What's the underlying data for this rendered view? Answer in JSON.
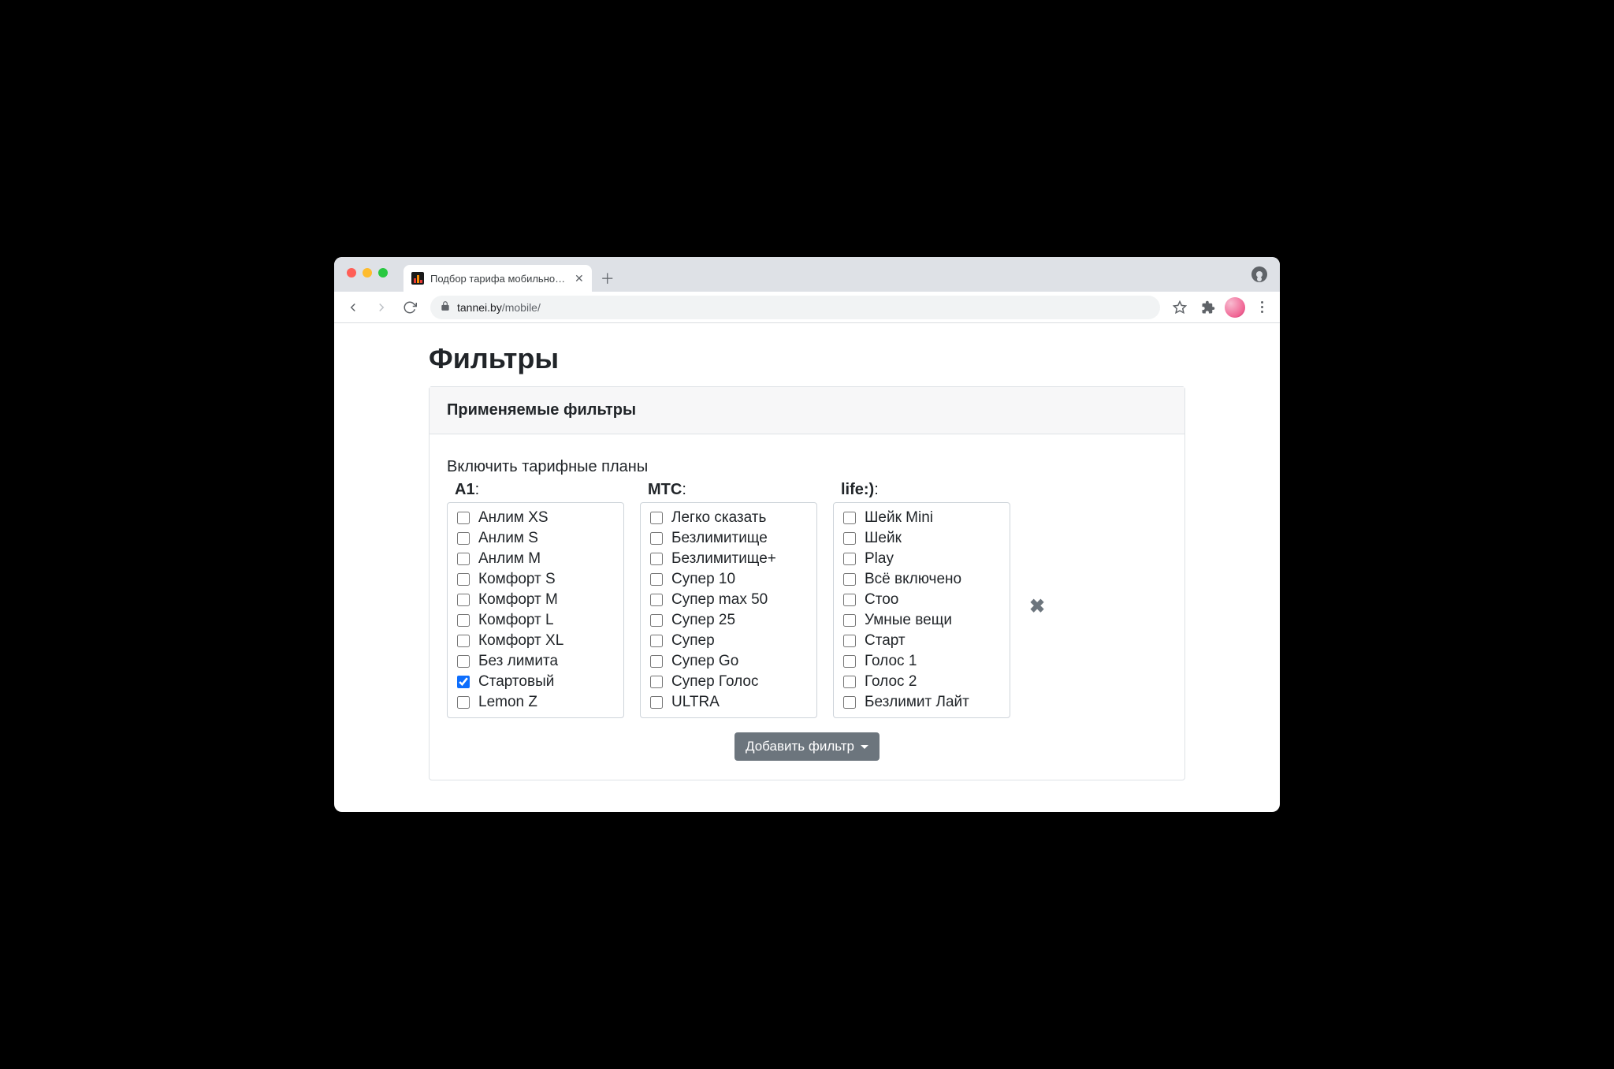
{
  "browser": {
    "tab_title": "Подбор тарифа мобильного о",
    "url_domain": "tannei.by",
    "url_path": "/mobile/"
  },
  "page": {
    "heading": "Фильтры",
    "card_header": "Применяемые фильтры",
    "section_label": "Включить тарифные планы",
    "add_filter_label": "Добавить фильтр",
    "operators": [
      {
        "name": "A1",
        "plans": [
          {
            "label": "Анлим XS",
            "checked": false
          },
          {
            "label": "Анлим S",
            "checked": false
          },
          {
            "label": "Анлим M",
            "checked": false
          },
          {
            "label": "Комфорт S",
            "checked": false
          },
          {
            "label": "Комфорт M",
            "checked": false
          },
          {
            "label": "Комфорт L",
            "checked": false
          },
          {
            "label": "Комфорт XL",
            "checked": false
          },
          {
            "label": "Без лимита",
            "checked": false
          },
          {
            "label": "Стартовый",
            "checked": true
          },
          {
            "label": "Lemon Z",
            "checked": false
          }
        ]
      },
      {
        "name": "МТС",
        "plans": [
          {
            "label": "Легко сказать",
            "checked": false
          },
          {
            "label": "Безлимитище",
            "checked": false
          },
          {
            "label": "Безлимитище+",
            "checked": false
          },
          {
            "label": "Супер 10",
            "checked": false
          },
          {
            "label": "Супер max 50",
            "checked": false
          },
          {
            "label": "Супер 25",
            "checked": false
          },
          {
            "label": "Супер",
            "checked": false
          },
          {
            "label": "Супер Go",
            "checked": false
          },
          {
            "label": "Супер Голос",
            "checked": false
          },
          {
            "label": "ULTRA",
            "checked": false
          }
        ]
      },
      {
        "name": "life:)",
        "plans": [
          {
            "label": "Шейк Mini",
            "checked": false
          },
          {
            "label": "Шейк",
            "checked": false
          },
          {
            "label": "Play",
            "checked": false
          },
          {
            "label": "Всё включено",
            "checked": false
          },
          {
            "label": "Стоо",
            "checked": false
          },
          {
            "label": "Умные вещи",
            "checked": false
          },
          {
            "label": "Старт",
            "checked": false
          },
          {
            "label": "Голос 1",
            "checked": false
          },
          {
            "label": "Голос 2",
            "checked": false
          },
          {
            "label": "Безлимит Лайт",
            "checked": false
          }
        ]
      }
    ]
  }
}
